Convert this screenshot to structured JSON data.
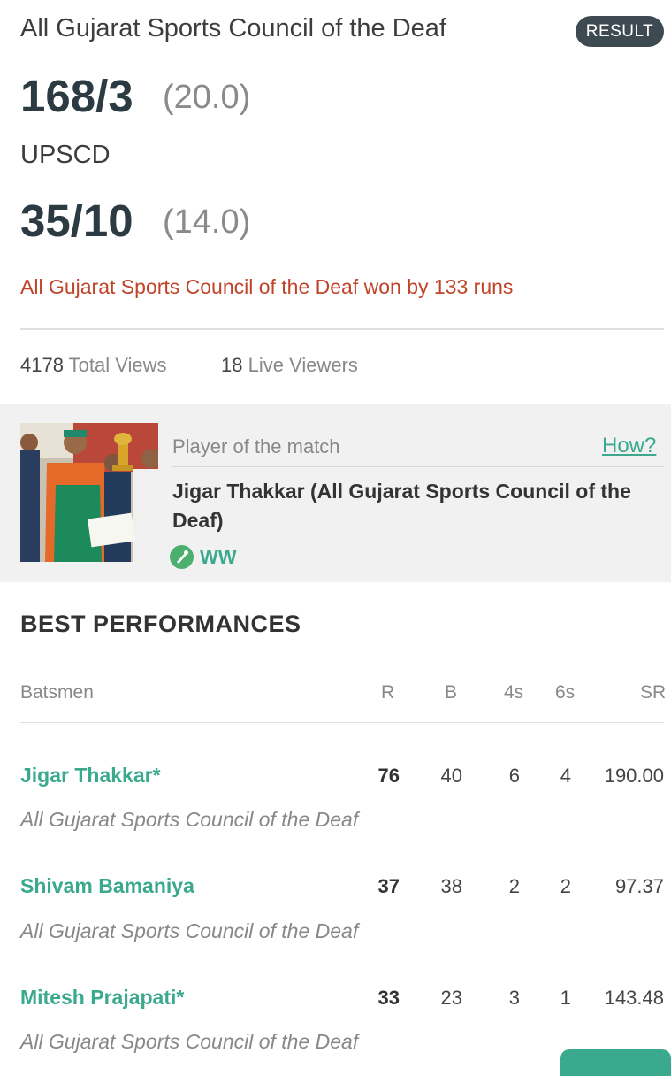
{
  "match": {
    "team1": {
      "name": "All Gujarat Sports Council of the Deaf",
      "score": "168/3",
      "overs": "(20.0)"
    },
    "team2": {
      "name": "UPSCD",
      "score": "35/10",
      "overs": "(14.0)"
    },
    "status_badge": "RESULT",
    "result_text": "All Gujarat Sports Council of the Deaf won by 133 runs"
  },
  "views": {
    "total_count": "4178",
    "total_label": "Total Views",
    "live_count": "18",
    "live_label": "Live Viewers"
  },
  "player_of_match": {
    "label": "Player of the match",
    "how_link": "How?",
    "player": "Jigar Thakkar (All Gujarat Sports Council of the Deaf)",
    "role": "WW",
    "role_icon": "wicket-keeper-gloves-icon"
  },
  "best_performances": {
    "title": "BEST PERFORMANCES",
    "headers": {
      "category": "Batsmen",
      "r": "R",
      "b": "B",
      "fours": "4s",
      "sixes": "6s",
      "sr": "SR"
    },
    "batsmen": [
      {
        "name": "Jigar Thakkar*",
        "team": "All Gujarat Sports Council of the Deaf",
        "r": "76",
        "b": "40",
        "fours": "6",
        "sixes": "4",
        "sr": "190.00"
      },
      {
        "name": "Shivam Bamaniya",
        "team": "All Gujarat Sports Council of the Deaf",
        "r": "37",
        "b": "38",
        "fours": "2",
        "sixes": "2",
        "sr": "97.37"
      },
      {
        "name": "Mitesh Prajapati*",
        "team": "All Gujarat Sports Council of the Deaf",
        "r": "33",
        "b": "23",
        "fours": "3",
        "sixes": "1",
        "sr": "143.48"
      }
    ]
  },
  "colors": {
    "accent": "#3aa98e",
    "result": "#c0442a",
    "badge": "#3e4a52"
  }
}
